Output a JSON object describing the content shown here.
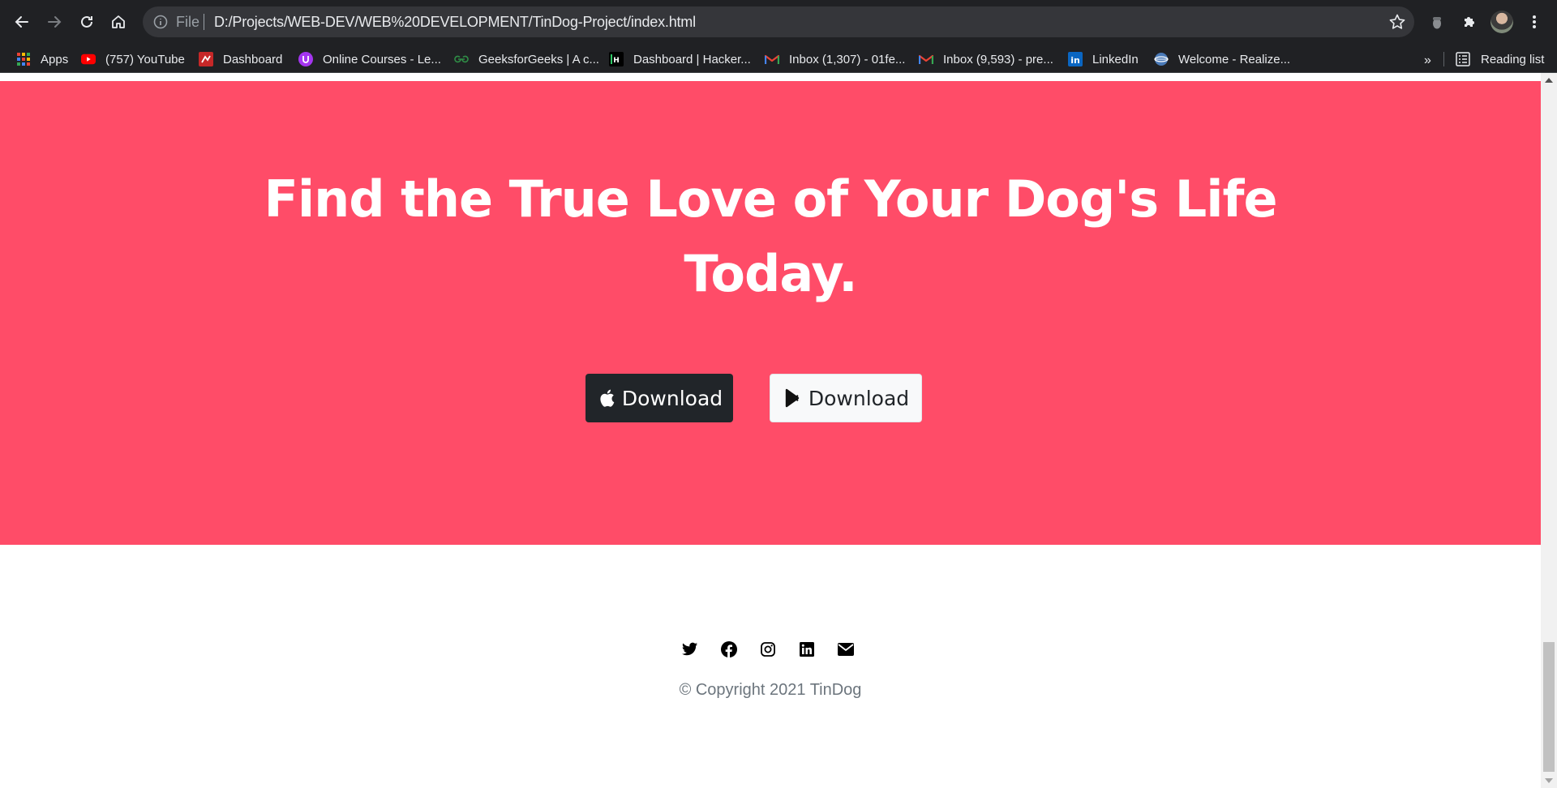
{
  "browser": {
    "omnibox": {
      "scheme_label": "File",
      "url": "D:/Projects/WEB-DEV/WEB%20DEVELOPMENT/TinDog-Project/index.html"
    },
    "bookmarks": [
      {
        "label": "Apps",
        "icon": "apps-grid-icon"
      },
      {
        "label": "(757) YouTube",
        "icon": "youtube-icon"
      },
      {
        "label": "Dashboard",
        "icon": "dashboard-icon"
      },
      {
        "label": "Online Courses - Le...",
        "icon": "udemy-icon"
      },
      {
        "label": "GeeksforGeeks | A c...",
        "icon": "geeksforgeeks-icon"
      },
      {
        "label": "Dashboard | Hacker...",
        "icon": "hackerrank-icon"
      },
      {
        "label": "Inbox (1,307) - 01fe...",
        "icon": "gmail-icon"
      },
      {
        "label": "Inbox (9,593) - pre...",
        "icon": "gmail-icon"
      },
      {
        "label": "LinkedIn",
        "icon": "linkedin-icon"
      },
      {
        "label": "Welcome - Realize...",
        "icon": "globe-icon"
      }
    ],
    "overflow_label": "»",
    "reading_list_label": "Reading list"
  },
  "page": {
    "cta": {
      "title": "Find the True Love of Your Dog's Life Today.",
      "apple_button_label": "Download",
      "play_button_label": "Download",
      "background_color": "#ff4c68"
    },
    "footer": {
      "social_icons": [
        "twitter-icon",
        "facebook-icon",
        "instagram-icon",
        "linkedin-icon",
        "envelope-icon"
      ],
      "copyright": "© Copyright 2021 TinDog"
    }
  }
}
